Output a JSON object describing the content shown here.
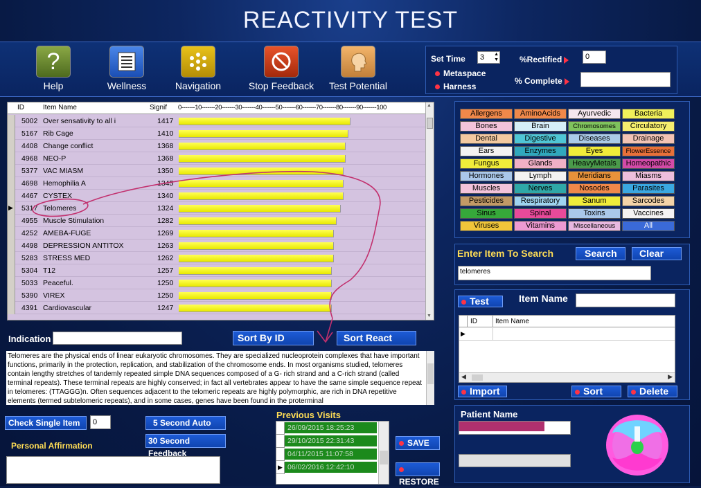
{
  "app": {
    "title": "REACTIVITY TEST"
  },
  "toolbar": [
    {
      "label": "Help",
      "icon": "question-mark-icon"
    },
    {
      "label": "Wellness",
      "icon": "list-icon"
    },
    {
      "label": "Navigation",
      "icon": "asterisk-icon"
    },
    {
      "label": "Stop Feedback",
      "icon": "prohibited-icon"
    },
    {
      "label": "Test Potential",
      "icon": "head-profile-icon"
    }
  ],
  "settings": {
    "set_time_label": "Set Time",
    "set_time_value": "3",
    "metaspace_label": "Metaspace",
    "harness_label": "Harness",
    "rectified_label": "%Rectified",
    "rectified_value": "0",
    "complete_label": "% Complete",
    "complete_value": ""
  },
  "grid": {
    "columns": [
      "ID",
      "Item Name",
      "Signif",
      "0-------10-------20-------30-------40-------50-------60-------70-------80-------90-------100"
    ],
    "rows": [
      {
        "id": "5002",
        "name": "Over sensativity to all i",
        "signif": "1417",
        "pct": 0.74
      },
      {
        "id": "5167",
        "name": "Rib Cage",
        "signif": "1410",
        "pct": 0.73
      },
      {
        "id": "4408",
        "name": "Change conflict",
        "signif": "1368",
        "pct": 0.72
      },
      {
        "id": "4968",
        "name": "NEO-P",
        "signif": "1368",
        "pct": 0.72
      },
      {
        "id": "5377",
        "name": "VAC MIASM",
        "signif": "1350",
        "pct": 0.71
      },
      {
        "id": "4698",
        "name": "Hemophilia A",
        "signif": "1345",
        "pct": 0.71
      },
      {
        "id": "4467",
        "name": "CYSTEX",
        "signif": "1340",
        "pct": 0.71
      },
      {
        "id": "5317",
        "name": "Telomeres",
        "signif": "1324",
        "pct": 0.7,
        "current": true
      },
      {
        "id": "4955",
        "name": "Muscle Stimulation",
        "signif": "1282",
        "pct": 0.68
      },
      {
        "id": "4252",
        "name": "AMEBA-FUGE",
        "signif": "1269",
        "pct": 0.67
      },
      {
        "id": "4498",
        "name": "DEPRESSION ANTITOX",
        "signif": "1263",
        "pct": 0.67
      },
      {
        "id": "5283",
        "name": "STRESS MED",
        "signif": "1262",
        "pct": 0.67
      },
      {
        "id": "5304",
        "name": "T12",
        "signif": "1257",
        "pct": 0.66
      },
      {
        "id": "5033",
        "name": "Peaceful.",
        "signif": "1250",
        "pct": 0.66
      },
      {
        "id": "5390",
        "name": "VIREX",
        "signif": "1250",
        "pct": 0.66
      },
      {
        "id": "4391",
        "name": "Cardiovascular",
        "signif": "1247",
        "pct": 0.66
      }
    ]
  },
  "indication": {
    "label": "Indication",
    "value": ""
  },
  "sort": {
    "by_id": "Sort  By  ID",
    "react": "Sort React"
  },
  "description": "Telomeres are the physical ends of linear eukaryotic chromosomes. They are specialized nucleoprotein complexes that have important functions, primarily in the protection, replication, and stabilization of the chromosome ends. In most organisms studied, telomeres contain lengthy stretches of tandemly repeated simple DNA sequences composed of a G- rich strand and a C-rich strand (called terminal repeats). These terminal repeats are highly conserved; in fact all vertebrates appear to have the same simple sequence repeat in telomeres: (TTAGGG)n. Often sequences adjacent to the telomeric repeats are highly polymorphic, are rich in DNA repetitive elements (termed subtelomeric repeats), and in some cases, genes have been found in the proterminal",
  "bottom": {
    "check_single": "Check Single Item",
    "check_value": "0",
    "five_sec": "5 Second Auto",
    "thirty_sec": "30 Second Feedback",
    "affirmation_label": "Personal Affirmation",
    "affirmation_value": ""
  },
  "visits": {
    "label": "Previous Visits",
    "items": [
      "26/09/2015 18:25:23",
      "29/10/2015 22:31:43",
      "04/11/2015 11:07:58",
      "06/02/2016 12:42:10"
    ],
    "save": "SAVE",
    "restore": "RESTORE"
  },
  "categories": [
    {
      "label": "Allergens",
      "color": "#f0884a"
    },
    {
      "label": "AminoAcids",
      "color": "#f0884a"
    },
    {
      "label": "Ayurvedic",
      "color": "#f6e6ee"
    },
    {
      "label": "Bacteria",
      "color": "#f0f05a"
    },
    {
      "label": "Bones",
      "color": "#f3c3da"
    },
    {
      "label": "Brain",
      "color": "#d6eef8"
    },
    {
      "label": "Chromosomes",
      "color": "#7fc35d"
    },
    {
      "label": "Circulatory",
      "color": "#f7ee6e"
    },
    {
      "label": "Dental",
      "color": "#f4c9a0"
    },
    {
      "label": "Digestive",
      "color": "#4fc6d6"
    },
    {
      "label": "Diseases",
      "color": "#aacbe8"
    },
    {
      "label": "Drainage",
      "color": "#f3c3b5"
    },
    {
      "label": "Ears",
      "color": "#f4f2f2"
    },
    {
      "label": "Enzymes",
      "color": "#30a8bd"
    },
    {
      "label": "Eyes",
      "color": "#f0ec3a"
    },
    {
      "label": "FlowerEssence",
      "color": "#e8703a"
    },
    {
      "label": "Fungus",
      "color": "#f0ec3a"
    },
    {
      "label": "Glands",
      "color": "#f0b0c6"
    },
    {
      "label": "HeavyMetals",
      "color": "#4a9a4a"
    },
    {
      "label": "Homeopathic",
      "color": "#d44aa8"
    },
    {
      "label": "Hormones",
      "color": "#aac8ea"
    },
    {
      "label": "Lymph",
      "color": "#f4f2f2"
    },
    {
      "label": "Meridians",
      "color": "#e8923a"
    },
    {
      "label": "Miasms",
      "color": "#eebedc"
    },
    {
      "label": "Muscles",
      "color": "#f3c3da"
    },
    {
      "label": "Nerves",
      "color": "#2fa8a8"
    },
    {
      "label": "Nosodes",
      "color": "#f0884a"
    },
    {
      "label": "Parasites",
      "color": "#3aa8e2"
    },
    {
      "label": "Pesticides",
      "color": "#c29a66"
    },
    {
      "label": "Respiratory",
      "color": "#9ed4f0"
    },
    {
      "label": "Sanum",
      "color": "#f0ec3a"
    },
    {
      "label": "Sarcodes",
      "color": "#f3d3a8"
    },
    {
      "label": "Sinus",
      "color": "#36a83a"
    },
    {
      "label": "Spinal",
      "color": "#e84a9a"
    },
    {
      "label": "Toxins",
      "color": "#aac8ea"
    },
    {
      "label": "Vaccines",
      "color": "#f4f2f2"
    },
    {
      "label": "Viruses",
      "color": "#f0c53a"
    },
    {
      "label": "Vitamins",
      "color": "#ee9ad2"
    },
    {
      "label": "Miscellaneous",
      "color": "#e8b8e0"
    },
    {
      "label": "All",
      "color": "#3a6ad8"
    }
  ],
  "search": {
    "label": "Enter Item To Search",
    "button": "Search",
    "clear": "Clear",
    "value": "telomeres"
  },
  "test": {
    "button": "Test",
    "item_name_label": "Item Name",
    "item_name_value": "",
    "columns": [
      "ID",
      "Item Name"
    ],
    "import": "Import",
    "sort": "Sort",
    "delete": "Delete"
  },
  "patient": {
    "label": "Patient Name",
    "value": "",
    "field2": ""
  }
}
